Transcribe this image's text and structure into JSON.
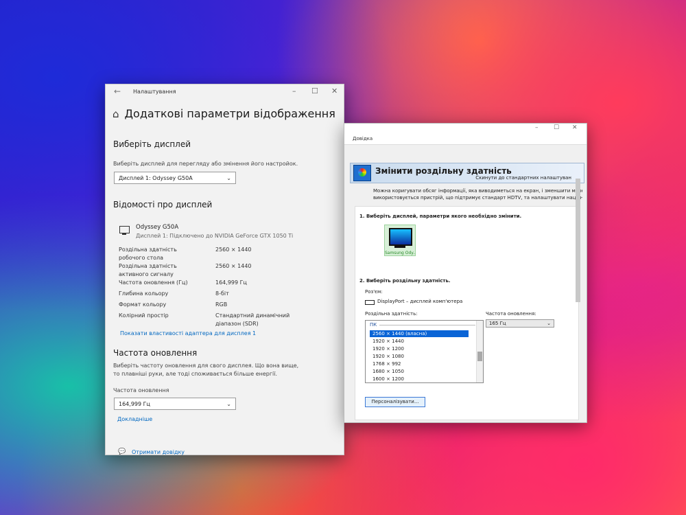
{
  "settings": {
    "app_title": "Налаштування",
    "page_title": "Додаткові параметри відображення",
    "select_display": {
      "heading": "Виберіть дисплей",
      "description": "Виберіть дисплей для перегляду або змінення його настройок.",
      "selected": "Дисплей 1: Odyssey G50A"
    },
    "display_info": {
      "heading": "Відомості про дисплей",
      "name": "Odyssey G50A",
      "connection": "Дисплей 1: Підключено до NVIDIA GeForce GTX 1050 Ti",
      "rows": [
        {
          "label": "Роздільна здатність робочого стола",
          "value": "2560 × 1440"
        },
        {
          "label": "Роздільна здатність активного сигналу",
          "value": "2560 × 1440"
        },
        {
          "label": "Частота оновлення (Гц)",
          "value": "164,999 Гц"
        },
        {
          "label": "Глибина кольору",
          "value": "8-біт"
        },
        {
          "label": "Формат кольору",
          "value": "RGB"
        },
        {
          "label": "Колірний простір",
          "value": "Стандартний динамічний діапазон (SDR)"
        }
      ],
      "adapter_link": "Показати властивості адаптера для дисплея 1"
    },
    "refresh": {
      "heading": "Частота оновлення",
      "description": "Виберіть частоту оновлення для свого дисплея. Що вона вище, то плавніші руки, але тоді споживається більше енергії.",
      "field_label": "Частота оновлення",
      "selected": "164,999 Гц",
      "more_link": "Докладніше"
    },
    "help_link": "Отримати довідку"
  },
  "resolution": {
    "menu_help": "Довідка",
    "title": "Змінити роздільну здатність",
    "restore_link": "Скинути до стандартних налаштуван",
    "info_line1": "Можна коригувати обсяг інформації, яка виводиметься на екран, і зменшити мерехтіння. Т",
    "info_line2": "використовується пристрій, що підтримує стандарт HDTV, та налаштувати національний форм",
    "step1": "1. Виберіть дисплей, параметри якого необхідно змінити.",
    "monitor_label": "Samsung Ody...",
    "step2": "2. Виберіть роздільну здатність.",
    "connector_label": "Роз'єм:",
    "connector_value": "DisplayPort – дисплей комп'ютера",
    "resolution_label": "Роздільна здатність:",
    "refresh_label": "Частота оновлення:",
    "refresh_value": "165 Гц",
    "list_group": "ПК",
    "resolutions": [
      "2560 × 1440 (власна)",
      "1920 × 1440",
      "1920 × 1200",
      "1920 × 1080",
      "1768 × 992",
      "1680 × 1050",
      "1600 × 1200"
    ],
    "customize_button": "Персоналізувати..."
  }
}
